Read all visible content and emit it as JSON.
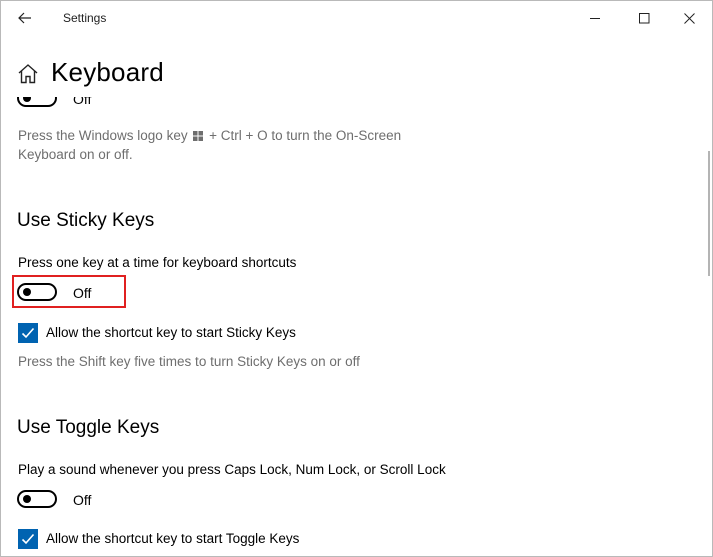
{
  "window": {
    "app_title": "Settings"
  },
  "header": {
    "page_title": "Keyboard"
  },
  "onscreen_keyboard": {
    "toggle_state": "Off",
    "description_line1": "Press the Windows logo key",
    "description_line1_suffix": "+ Ctrl + O to turn the On-Screen",
    "description_line2": "Keyboard on or off."
  },
  "sticky_keys": {
    "heading": "Use Sticky Keys",
    "setting_label": "Press one key at a time for keyboard shortcuts",
    "toggle_state": "Off",
    "shortcut_checkbox_label": "Allow the shortcut key to start Sticky Keys",
    "shortcut_checked": true,
    "shortcut_hint": "Press the Shift key five times to turn Sticky Keys on or off"
  },
  "toggle_keys": {
    "heading": "Use Toggle Keys",
    "setting_label": "Play a sound whenever you press Caps Lock, Num Lock, or Scroll Lock",
    "toggle_state": "Off",
    "shortcut_checkbox_label": "Allow the shortcut key to start Toggle Keys",
    "shortcut_checked": true
  },
  "colors": {
    "accent": "#0063b1",
    "highlight": "#e02020",
    "secondary_text": "#6e6e6e"
  },
  "icons": {
    "back": "back-arrow-icon",
    "home": "home-icon",
    "minimize": "minimize-icon",
    "maximize": "maximize-icon",
    "close": "close-icon",
    "checkmark": "checkmark-icon",
    "windows_logo": "windows-logo-icon"
  }
}
